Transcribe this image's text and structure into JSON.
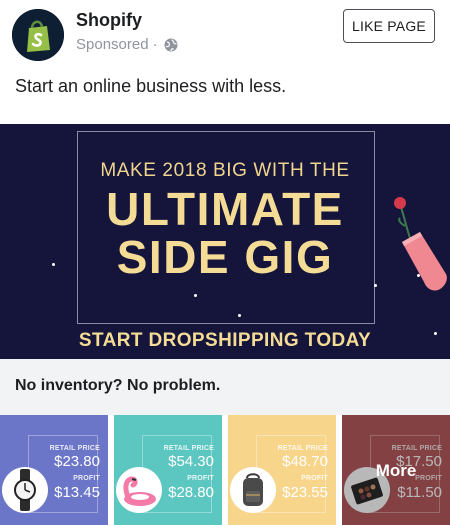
{
  "header": {
    "page_name": "Shopify",
    "sponsored": "Sponsored",
    "separator": "·",
    "like_button": "LIKE PAGE",
    "avatar_icon": "shopify-bag-icon",
    "audience_icon": "globe-icon"
  },
  "post": {
    "text": "Start an online business with less."
  },
  "banner": {
    "line1": "MAKE 2018 BIG WITH THE",
    "line2": "ULTIMATE",
    "line3": "SIDE GIG",
    "cta": "START DROPSHIPPING TODAY",
    "background": "#15143a",
    "text_color": "#f4dc96"
  },
  "sub_headline": "No inventory? No problem.",
  "carousel": {
    "cards": [
      {
        "bg": "#6c76c9",
        "retail_label": "RETAIL PRICE",
        "retail": "$23.80",
        "profit_label": "PROFIT",
        "profit": "$13.45",
        "icon": "watch-icon"
      },
      {
        "bg": "#5cc7c0",
        "retail_label": "RETAIL PRICE",
        "retail": "$54.30",
        "profit_label": "PROFIT",
        "profit": "$28.80",
        "icon": "flamingo-float-icon"
      },
      {
        "bg": "#f7d68c",
        "retail_label": "RETAIL PRICE",
        "retail": "$48.70",
        "profit_label": "PROFIT",
        "profit": "$23.55",
        "icon": "backpack-icon"
      },
      {
        "bg": "#b85a5f",
        "retail_label": "RETAIL PRICE",
        "retail": "$17.50",
        "profit_label": "PROFIT",
        "profit": "$11.50",
        "icon": "makeup-palette-icon",
        "more": "More"
      }
    ]
  }
}
